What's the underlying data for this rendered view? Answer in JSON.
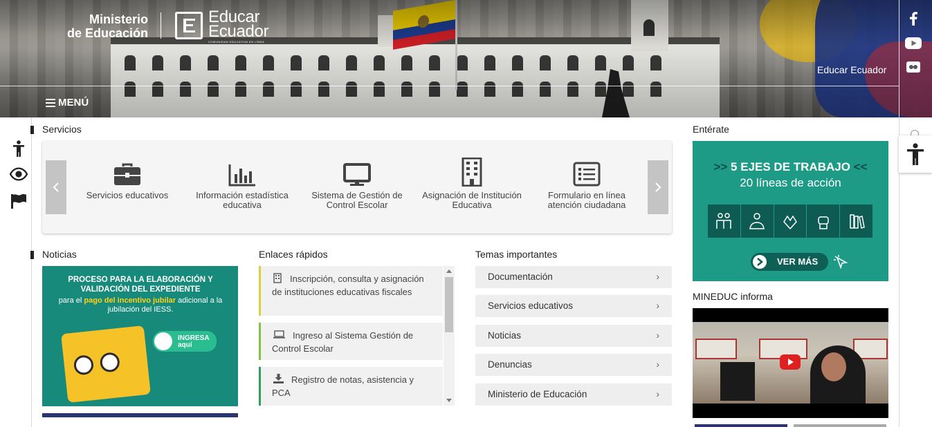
{
  "header": {
    "ministry_line1": "Ministerio",
    "ministry_line2": "de Educación",
    "brand_line1": "Educar",
    "brand_line2": "Ecuador",
    "brand_tagline": "COMUNIDAD EDUCATIVA EN LÍNEA",
    "menu_label": "MENÚ",
    "educar_link": "Educar Ecuador",
    "social_icons": [
      "facebook-icon",
      "youtube-icon",
      "flickr-icon"
    ]
  },
  "servicios": {
    "title": "Servicios",
    "items": [
      {
        "icon": "briefcase-icon",
        "label": "Servicios educativos"
      },
      {
        "icon": "bar-chart-icon",
        "label": "Información estadística educativa"
      },
      {
        "icon": "monitor-icon",
        "label": "Sistema de Gestión de Control Escolar"
      },
      {
        "icon": "building-icon",
        "label": "Asignación de Institución Educativa"
      },
      {
        "icon": "list-form-icon",
        "label": "Formulario en línea atención ciudadana"
      }
    ]
  },
  "noticias": {
    "title": "Noticias",
    "banner_title": "PROCESO PARA LA ELABORACIÓN Y VALIDACIÓN DEL EXPEDIENTE",
    "banner_sub_pre": "para el ",
    "banner_sub_bold": "pago del incentivo jubilar",
    "banner_sub_post": " adicional a la jubilación del IESS.",
    "banner_button_line1": "INGRESA",
    "banner_button_line2": "aquí"
  },
  "enlaces": {
    "title": "Enlaces rápidos",
    "items": [
      {
        "icon": "building-icon",
        "label": "Inscripción, consulta y asignación de instituciones educativas fiscales",
        "accent": "#d9d13b"
      },
      {
        "icon": "laptop-icon",
        "label": "Ingreso al Sistema Gestión de Control Escolar",
        "accent": "#7fc24a"
      },
      {
        "icon": "download-icon",
        "label": "Registro de notas, asistencia y PCA",
        "accent": "#2f9e5c"
      }
    ]
  },
  "temas": {
    "title": "Temas importantes",
    "items": [
      "Documentación",
      "Servicios educativos",
      "Noticias",
      "Denuncias",
      "Ministerio de Educación"
    ]
  },
  "enterate": {
    "title": "Entérate",
    "banner_title": "5 EJES DE TRABAJO",
    "banner_sub": "20 líneas de acción",
    "banner_button": "VER MÁS"
  },
  "mineduc": {
    "title": "MINEDUC informa"
  },
  "colors": {
    "teal_banner": "#1e9b87",
    "news_banner": "#178a7c",
    "navy": "#2c3470",
    "flag_yellow": "#f6d400",
    "flag_blue": "#1d3e93",
    "flag_red": "#d32027"
  }
}
